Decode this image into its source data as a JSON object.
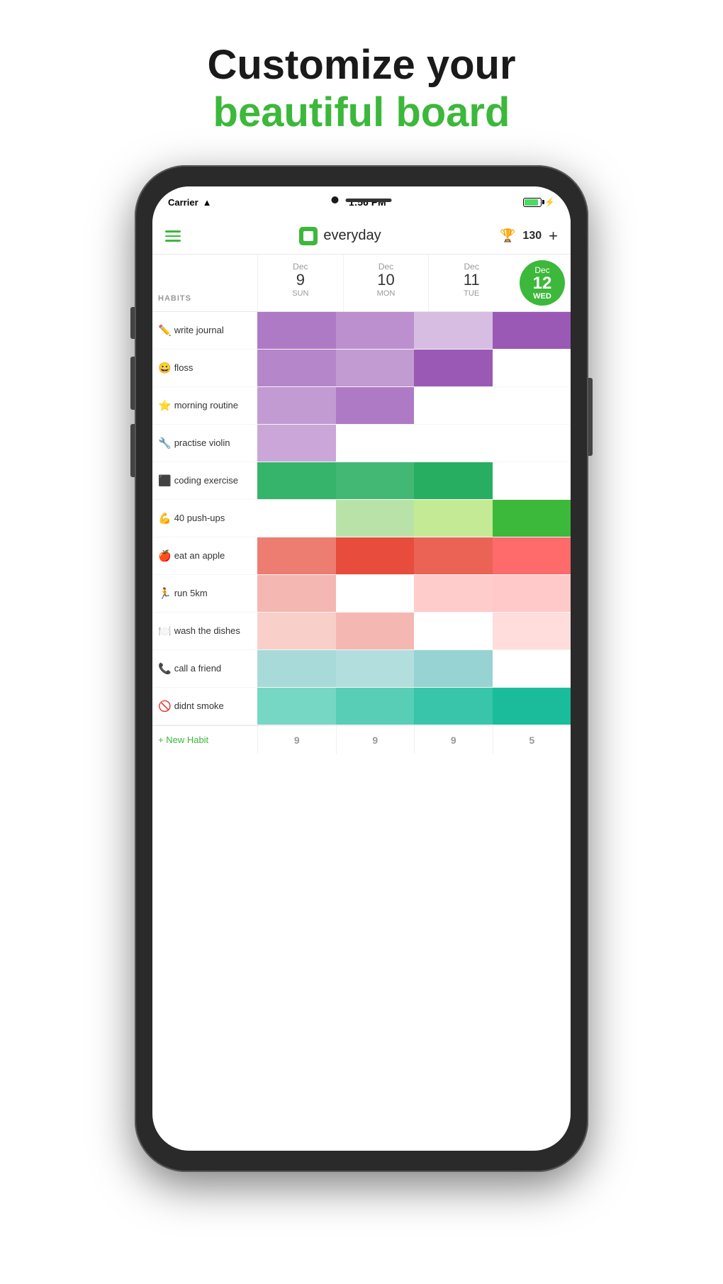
{
  "headline": {
    "line1": "Customize your",
    "line2": "beautiful board"
  },
  "status_bar": {
    "carrier": "Carrier",
    "time": "1:56 PM"
  },
  "nav": {
    "app_name": "everyday",
    "score": "130",
    "plus": "+"
  },
  "habits_label": "HABITS",
  "dates": [
    {
      "month": "Dec",
      "num": "9",
      "day": "SUN",
      "today": false
    },
    {
      "month": "Dec",
      "num": "10",
      "day": "MON",
      "today": false
    },
    {
      "month": "Dec",
      "num": "11",
      "day": "TUE",
      "today": false
    },
    {
      "month": "Dec",
      "num": "12",
      "day": "WED",
      "today": true
    }
  ],
  "habits": [
    {
      "emoji": "✏️",
      "name": "write journal",
      "cells": [
        "#9b59b6cc",
        "#9b59b6aa",
        "#9b59b666",
        "#9b59b6ff"
      ]
    },
    {
      "emoji": "😀",
      "name": "floss",
      "cells": [
        "#9b59b6bb",
        "#9b59b699",
        "#9b59b6ff",
        "#ffffff00"
      ]
    },
    {
      "emoji": "⭐",
      "name": "morning routine",
      "cells": [
        "#9b59b699",
        "#9b59b6cc",
        "#ffffff00",
        "#ffffff00"
      ]
    },
    {
      "emoji": "🔧",
      "name": "practise violin",
      "cells": [
        "#9b59b688",
        "#ffffff00",
        "#ffffff00",
        "#ffffff00"
      ]
    },
    {
      "emoji": "⬛",
      "name": "coding exercise",
      "cells": [
        "#27ae60ee",
        "#27ae60dd",
        "#27ae60ff",
        "#ffffff00"
      ]
    },
    {
      "emoji": "💪",
      "name": "40 push-ups",
      "cells": [
        "#ffffff22",
        "#7ac85a88",
        "#a8e063aa",
        "#3cb83aff"
      ]
    },
    {
      "emoji": "🍎",
      "name": "eat an apple",
      "cells": [
        "#e74c3cbb",
        "#e74c3cff",
        "#e74c3cdd",
        "#ff6b6bff"
      ]
    },
    {
      "emoji": "🏃",
      "name": "run 5km",
      "cells": [
        "#e74c3c66",
        "#ffffff00",
        "#ffaaaa99",
        "#ffbbbbcc"
      ]
    },
    {
      "emoji": "🍽️",
      "name": "wash the dishes",
      "cells": [
        "#e74c3c44",
        "#e74c3c66",
        "#ffffff00",
        "#ffccccaa"
      ]
    },
    {
      "emoji": "📞",
      "name": "call a friend",
      "cells": [
        "#7ec8c8aa",
        "#7ec8c899",
        "#7ec8c8cc",
        "#ffffff00"
      ]
    },
    {
      "emoji": "🚫",
      "name": "didnt smoke",
      "cells": [
        "#1abc9c99",
        "#1abc9cbb",
        "#1abc9cdd",
        "#1abc9cff"
      ]
    }
  ],
  "bottom": {
    "new_habit": "+ New Habit",
    "scores": [
      "9",
      "9",
      "9",
      "5"
    ]
  }
}
